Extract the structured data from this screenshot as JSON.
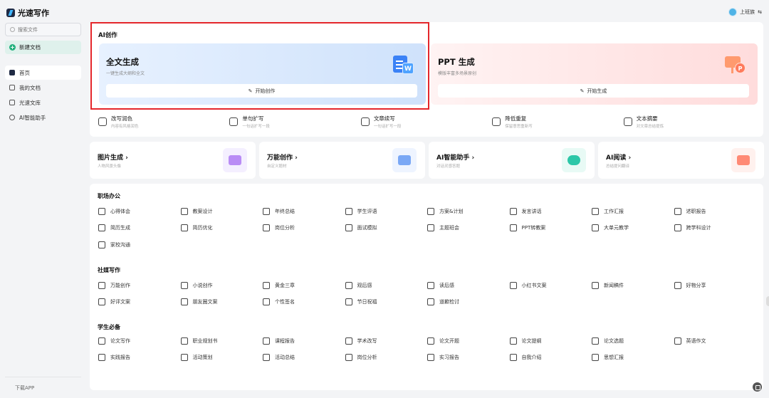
{
  "app": {
    "name": "光速写作"
  },
  "sidebar": {
    "search_placeholder": "搜索文件",
    "new_doc": "新建文档",
    "items": [
      {
        "label": "首页",
        "icon": "home-icon",
        "active": true
      },
      {
        "label": "我的文档",
        "icon": "doc-icon",
        "active": false
      },
      {
        "label": "光速文库",
        "icon": "library-icon",
        "active": false
      },
      {
        "label": "AI智能助手",
        "icon": "chat-icon",
        "active": false
      }
    ],
    "download": "下载APP"
  },
  "user": {
    "name": "上班族"
  },
  "ai": {
    "title": "AI创作",
    "full_text": {
      "title": "全文生成",
      "subtitle": "一键生成大纲和全文",
      "button": "开始创作"
    },
    "ppt": {
      "title": "PPT 生成",
      "subtitle": "模版丰富多场景原创",
      "button": "开始生成"
    },
    "tools": [
      {
        "title": "改写润色",
        "subtitle": "内容有风格润色"
      },
      {
        "title": "单句扩写",
        "subtitle": "一句话扩写一段"
      },
      {
        "title": "文章续写",
        "subtitle": "一句话扩写一段"
      },
      {
        "title": "降低重复",
        "subtitle": "保留意思重新写"
      },
      {
        "title": "文本摘要",
        "subtitle": "对文章总结提炼"
      }
    ]
  },
  "quick": [
    {
      "title": "图片生成 ›",
      "subtitle": "人物风景头像",
      "color": "#b98cf5"
    },
    {
      "title": "万能创作 ›",
      "subtitle": "自定义题材",
      "color": "#7aa8f5"
    },
    {
      "title": "AI智能助手 ›",
      "subtitle": "对话灵感答题",
      "color": "#2cc7a8"
    },
    {
      "title": "AI阅读 ›",
      "subtitle": "总结提问翻译",
      "color": "#ff8a75"
    }
  ],
  "categories": [
    {
      "title": "职场办公",
      "items": [
        "心得体会",
        "教案设计",
        "年终总结",
        "学生评语",
        "方案&计划",
        "发言讲话",
        "工作汇报",
        "述职报告",
        "简历生成",
        "简历优化",
        "岗位分析",
        "面试模拟",
        "主题班会",
        "PPT转教案",
        "大单元教学",
        "跨学科设计",
        "家校沟通"
      ]
    },
    {
      "title": "社媒写作",
      "items": [
        "万能创作",
        "小说创作",
        "黄金三章",
        "观后感",
        "读后感",
        "小红书文案",
        "新闻稿件",
        "好物分享",
        "好评文案",
        "朋友圈文案",
        "个性签名",
        "节日祝福",
        "道歉检讨"
      ]
    },
    {
      "title": "学生必备",
      "items": [
        "论文写作",
        "职业规划书",
        "课程报告",
        "学术改写",
        "论文开题",
        "论文提纲",
        "论文选题",
        "英语作文",
        "实践报告",
        "活动策划",
        "活动总结",
        "岗位分析",
        "实习报告",
        "自我介绍",
        "思想汇报"
      ]
    }
  ]
}
